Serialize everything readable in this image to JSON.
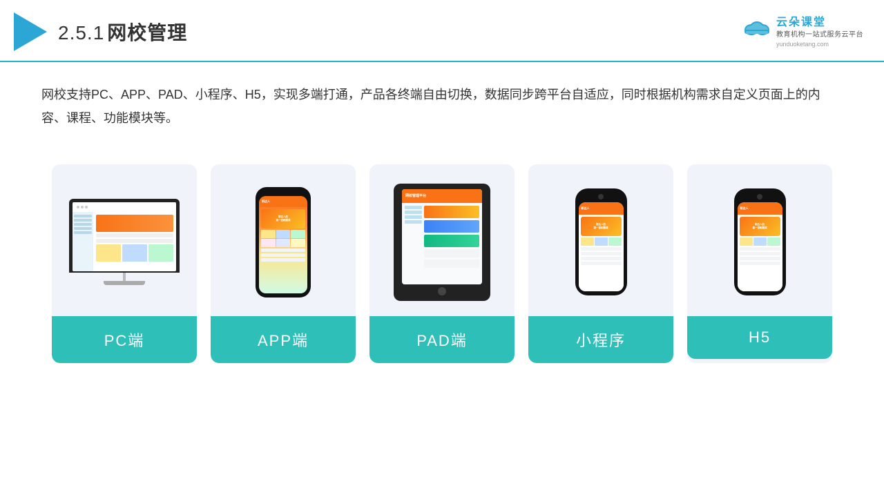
{
  "header": {
    "title": "2.5.1网校管理",
    "title_num": "2.5.1",
    "title_text": "网校管理",
    "logo_name": "云朵课堂",
    "logo_slogan": "教育机构一站式服务云平台",
    "logo_url": "yunduoketang.com"
  },
  "description": {
    "text": "网校支持PC、APP、PAD、小程序、H5，实现多端打通，产品各终端自由切换，数据同步跨平台自适应，同时根据机构需求自定义页面上的内容、课程、功能模块等。"
  },
  "cards": [
    {
      "id": "pc",
      "label": "PC端"
    },
    {
      "id": "app",
      "label": "APP端"
    },
    {
      "id": "pad",
      "label": "PAD端"
    },
    {
      "id": "miniprogram",
      "label": "小程序"
    },
    {
      "id": "h5",
      "label": "H5"
    }
  ]
}
